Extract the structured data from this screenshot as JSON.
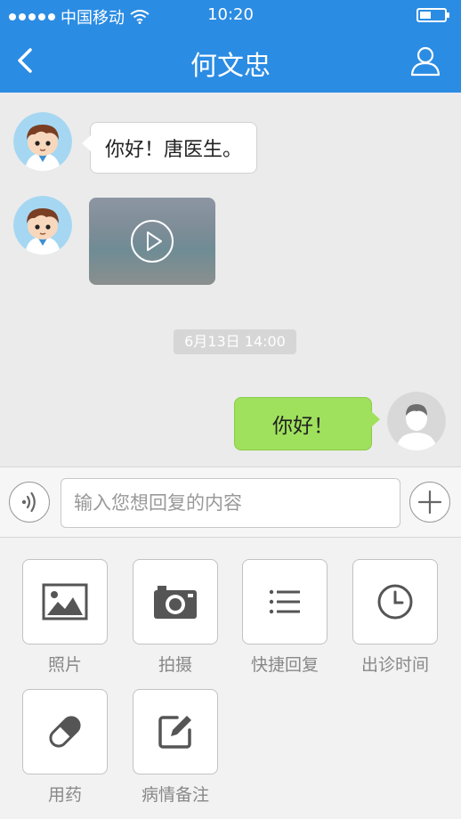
{
  "status_bar": {
    "carrier": "中国移动",
    "time": "10:20",
    "battery_level": 0.45
  },
  "nav": {
    "title": "何文忠",
    "back_icon": "chevron-left-icon",
    "profile_icon": "person-icon"
  },
  "messages": [
    {
      "side": "left",
      "text": "你好！唐医生。"
    },
    {
      "side": "left",
      "type": "video",
      "icon": "play-icon"
    },
    {
      "timestamp": "6月13日  14:00"
    },
    {
      "side": "right",
      "text": "你好！"
    }
  ],
  "input_bar": {
    "voice_icon": "voice-icon",
    "placeholder": "输入您想回复的内容",
    "value": "",
    "add_icon": "plus-icon"
  },
  "tools": [
    {
      "label": "照片",
      "icon": "image-icon"
    },
    {
      "label": "拍摄",
      "icon": "camera-icon"
    },
    {
      "label": "快捷回复",
      "icon": "list-icon"
    },
    {
      "label": "出诊时间",
      "icon": "clock-icon"
    },
    {
      "label": "用药",
      "icon": "pill-icon"
    },
    {
      "label": "病情备注",
      "icon": "edit-note-icon"
    }
  ],
  "colors": {
    "primary": "#2b8ce3",
    "chat_bg": "#ebebeb",
    "outgoing_bubble": "#9fe15c",
    "icon_gray": "#555555"
  }
}
